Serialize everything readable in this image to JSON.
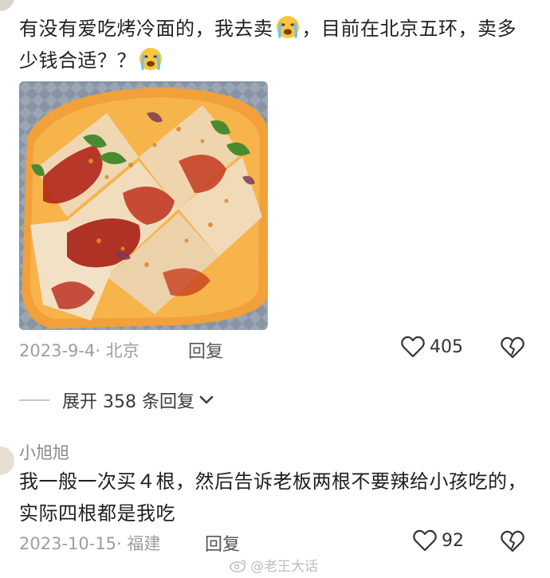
{
  "comment1": {
    "text": "有没有爱吃烤冷面的，我去卖😭，目前在北京五环，卖多少钱合适？？😭",
    "text_part1": "有没有爱吃烤冷面的，我去卖",
    "text_part2": "，目前在北京五环，卖多少钱合适？？",
    "emoji_icon": "crying-face-icon",
    "date_location": "2023-9-4· 北京",
    "reply_label": "回复",
    "likes": "405"
  },
  "expand_replies": {
    "label": "展开 358 条回复"
  },
  "comment2": {
    "username": "小旭旭",
    "text": "我一般一次买４根，然后告诉老板两根不要辣给小孩吃的，实际四根都是我吃",
    "date_location": "2023-10-15· 福建",
    "reply_label": "回复",
    "likes": "92"
  },
  "watermark": {
    "text": "@老王大话"
  },
  "colors": {
    "text": "#1f1f1f",
    "meta": "#9e9e9e",
    "icon": "#333333"
  }
}
